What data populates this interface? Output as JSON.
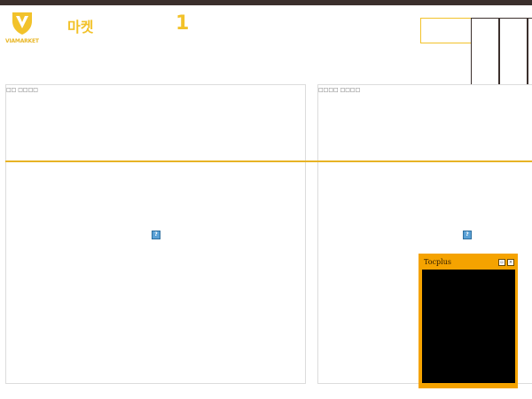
{
  "header": {
    "logo_text": "VIAMARKET",
    "market_title": "마켓",
    "count": "1"
  },
  "panels": [
    {
      "label": "□□ □□□□",
      "icon": "broken-image-icon",
      "icon_glyph": "?"
    },
    {
      "label": "□□□□ □□□□",
      "icon": "broken-image-icon",
      "icon_glyph": "?"
    }
  ],
  "widget": {
    "title": "Tocplus",
    "restore_glyph": "▫",
    "close_glyph": "×"
  },
  "colors": {
    "brand_yellow": "#f2c22a",
    "divider": "#e7b325",
    "topbar": "#3b2f2c",
    "widget_orange": "#f5a300"
  }
}
